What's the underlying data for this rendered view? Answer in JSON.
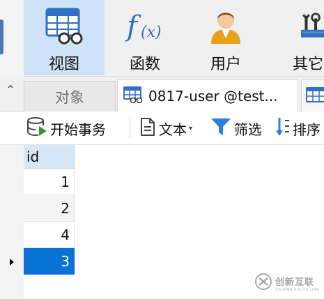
{
  "ribbon": {
    "buttons": [
      {
        "label": "视图",
        "icon": "table-view-icon",
        "active": true
      },
      {
        "label": "函数",
        "icon": "function-icon",
        "active": false
      },
      {
        "label": "用户",
        "icon": "user-icon",
        "active": false
      },
      {
        "label": "其它",
        "icon": "tools-icon",
        "active": false
      }
    ]
  },
  "tabs": {
    "objects_label": "对象",
    "active_tab_label": "0817-user @test...",
    "active_tab_icon": "table-icon",
    "next_tab_icon": "table-icon"
  },
  "toolbar": {
    "begin_transaction": "开始事务",
    "text": "文本",
    "filter": "筛选",
    "sort": "排序"
  },
  "grid": {
    "column": "id",
    "rows": [
      "1",
      "2",
      "4",
      "3"
    ],
    "selected_row_index": 3
  },
  "watermark": {
    "cn": "创新互联",
    "en": "CHUANG XIN HU LIAN"
  },
  "colors": {
    "ribbon_active": "#cfe3f8",
    "header_bg": "#d6e8f7",
    "selection": "#0a74d6",
    "accent_blue": "#2f6fc4"
  }
}
